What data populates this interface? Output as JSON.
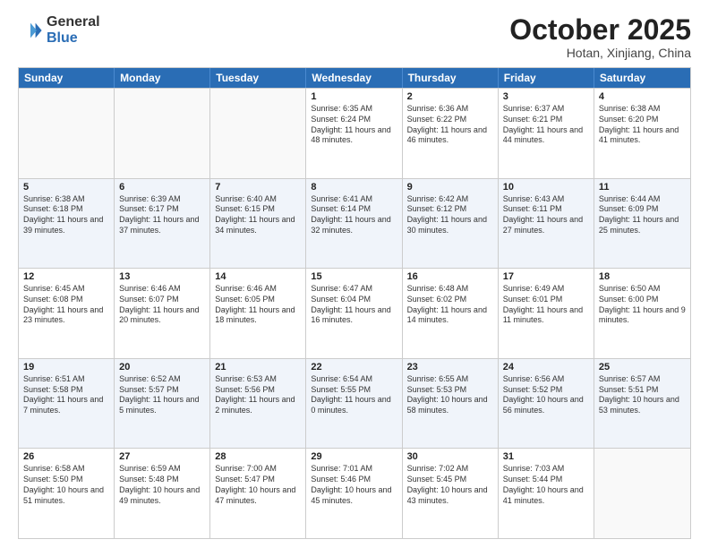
{
  "logo": {
    "general": "General",
    "blue": "Blue"
  },
  "title": "October 2025",
  "subtitle": "Hotan, Xinjiang, China",
  "header_days": [
    "Sunday",
    "Monday",
    "Tuesday",
    "Wednesday",
    "Thursday",
    "Friday",
    "Saturday"
  ],
  "rows": [
    {
      "alt": false,
      "cells": [
        {
          "day": "",
          "sunrise": "",
          "sunset": "",
          "daylight": "",
          "empty": true
        },
        {
          "day": "",
          "sunrise": "",
          "sunset": "",
          "daylight": "",
          "empty": true
        },
        {
          "day": "",
          "sunrise": "",
          "sunset": "",
          "daylight": "",
          "empty": true
        },
        {
          "day": "1",
          "sunrise": "Sunrise: 6:35 AM",
          "sunset": "Sunset: 6:24 PM",
          "daylight": "Daylight: 11 hours and 48 minutes.",
          "empty": false
        },
        {
          "day": "2",
          "sunrise": "Sunrise: 6:36 AM",
          "sunset": "Sunset: 6:22 PM",
          "daylight": "Daylight: 11 hours and 46 minutes.",
          "empty": false
        },
        {
          "day": "3",
          "sunrise": "Sunrise: 6:37 AM",
          "sunset": "Sunset: 6:21 PM",
          "daylight": "Daylight: 11 hours and 44 minutes.",
          "empty": false
        },
        {
          "day": "4",
          "sunrise": "Sunrise: 6:38 AM",
          "sunset": "Sunset: 6:20 PM",
          "daylight": "Daylight: 11 hours and 41 minutes.",
          "empty": false
        }
      ]
    },
    {
      "alt": true,
      "cells": [
        {
          "day": "5",
          "sunrise": "Sunrise: 6:38 AM",
          "sunset": "Sunset: 6:18 PM",
          "daylight": "Daylight: 11 hours and 39 minutes.",
          "empty": false
        },
        {
          "day": "6",
          "sunrise": "Sunrise: 6:39 AM",
          "sunset": "Sunset: 6:17 PM",
          "daylight": "Daylight: 11 hours and 37 minutes.",
          "empty": false
        },
        {
          "day": "7",
          "sunrise": "Sunrise: 6:40 AM",
          "sunset": "Sunset: 6:15 PM",
          "daylight": "Daylight: 11 hours and 34 minutes.",
          "empty": false
        },
        {
          "day": "8",
          "sunrise": "Sunrise: 6:41 AM",
          "sunset": "Sunset: 6:14 PM",
          "daylight": "Daylight: 11 hours and 32 minutes.",
          "empty": false
        },
        {
          "day": "9",
          "sunrise": "Sunrise: 6:42 AM",
          "sunset": "Sunset: 6:12 PM",
          "daylight": "Daylight: 11 hours and 30 minutes.",
          "empty": false
        },
        {
          "day": "10",
          "sunrise": "Sunrise: 6:43 AM",
          "sunset": "Sunset: 6:11 PM",
          "daylight": "Daylight: 11 hours and 27 minutes.",
          "empty": false
        },
        {
          "day": "11",
          "sunrise": "Sunrise: 6:44 AM",
          "sunset": "Sunset: 6:09 PM",
          "daylight": "Daylight: 11 hours and 25 minutes.",
          "empty": false
        }
      ]
    },
    {
      "alt": false,
      "cells": [
        {
          "day": "12",
          "sunrise": "Sunrise: 6:45 AM",
          "sunset": "Sunset: 6:08 PM",
          "daylight": "Daylight: 11 hours and 23 minutes.",
          "empty": false
        },
        {
          "day": "13",
          "sunrise": "Sunrise: 6:46 AM",
          "sunset": "Sunset: 6:07 PM",
          "daylight": "Daylight: 11 hours and 20 minutes.",
          "empty": false
        },
        {
          "day": "14",
          "sunrise": "Sunrise: 6:46 AM",
          "sunset": "Sunset: 6:05 PM",
          "daylight": "Daylight: 11 hours and 18 minutes.",
          "empty": false
        },
        {
          "day": "15",
          "sunrise": "Sunrise: 6:47 AM",
          "sunset": "Sunset: 6:04 PM",
          "daylight": "Daylight: 11 hours and 16 minutes.",
          "empty": false
        },
        {
          "day": "16",
          "sunrise": "Sunrise: 6:48 AM",
          "sunset": "Sunset: 6:02 PM",
          "daylight": "Daylight: 11 hours and 14 minutes.",
          "empty": false
        },
        {
          "day": "17",
          "sunrise": "Sunrise: 6:49 AM",
          "sunset": "Sunset: 6:01 PM",
          "daylight": "Daylight: 11 hours and 11 minutes.",
          "empty": false
        },
        {
          "day": "18",
          "sunrise": "Sunrise: 6:50 AM",
          "sunset": "Sunset: 6:00 PM",
          "daylight": "Daylight: 11 hours and 9 minutes.",
          "empty": false
        }
      ]
    },
    {
      "alt": true,
      "cells": [
        {
          "day": "19",
          "sunrise": "Sunrise: 6:51 AM",
          "sunset": "Sunset: 5:58 PM",
          "daylight": "Daylight: 11 hours and 7 minutes.",
          "empty": false
        },
        {
          "day": "20",
          "sunrise": "Sunrise: 6:52 AM",
          "sunset": "Sunset: 5:57 PM",
          "daylight": "Daylight: 11 hours and 5 minutes.",
          "empty": false
        },
        {
          "day": "21",
          "sunrise": "Sunrise: 6:53 AM",
          "sunset": "Sunset: 5:56 PM",
          "daylight": "Daylight: 11 hours and 2 minutes.",
          "empty": false
        },
        {
          "day": "22",
          "sunrise": "Sunrise: 6:54 AM",
          "sunset": "Sunset: 5:55 PM",
          "daylight": "Daylight: 11 hours and 0 minutes.",
          "empty": false
        },
        {
          "day": "23",
          "sunrise": "Sunrise: 6:55 AM",
          "sunset": "Sunset: 5:53 PM",
          "daylight": "Daylight: 10 hours and 58 minutes.",
          "empty": false
        },
        {
          "day": "24",
          "sunrise": "Sunrise: 6:56 AM",
          "sunset": "Sunset: 5:52 PM",
          "daylight": "Daylight: 10 hours and 56 minutes.",
          "empty": false
        },
        {
          "day": "25",
          "sunrise": "Sunrise: 6:57 AM",
          "sunset": "Sunset: 5:51 PM",
          "daylight": "Daylight: 10 hours and 53 minutes.",
          "empty": false
        }
      ]
    },
    {
      "alt": false,
      "cells": [
        {
          "day": "26",
          "sunrise": "Sunrise: 6:58 AM",
          "sunset": "Sunset: 5:50 PM",
          "daylight": "Daylight: 10 hours and 51 minutes.",
          "empty": false
        },
        {
          "day": "27",
          "sunrise": "Sunrise: 6:59 AM",
          "sunset": "Sunset: 5:48 PM",
          "daylight": "Daylight: 10 hours and 49 minutes.",
          "empty": false
        },
        {
          "day": "28",
          "sunrise": "Sunrise: 7:00 AM",
          "sunset": "Sunset: 5:47 PM",
          "daylight": "Daylight: 10 hours and 47 minutes.",
          "empty": false
        },
        {
          "day": "29",
          "sunrise": "Sunrise: 7:01 AM",
          "sunset": "Sunset: 5:46 PM",
          "daylight": "Daylight: 10 hours and 45 minutes.",
          "empty": false
        },
        {
          "day": "30",
          "sunrise": "Sunrise: 7:02 AM",
          "sunset": "Sunset: 5:45 PM",
          "daylight": "Daylight: 10 hours and 43 minutes.",
          "empty": false
        },
        {
          "day": "31",
          "sunrise": "Sunrise: 7:03 AM",
          "sunset": "Sunset: 5:44 PM",
          "daylight": "Daylight: 10 hours and 41 minutes.",
          "empty": false
        },
        {
          "day": "",
          "sunrise": "",
          "sunset": "",
          "daylight": "",
          "empty": true
        }
      ]
    }
  ]
}
